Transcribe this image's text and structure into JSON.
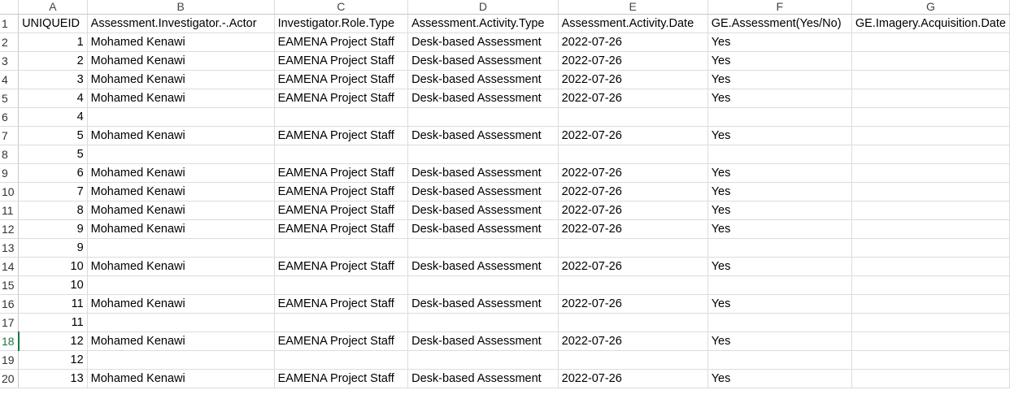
{
  "column_letters": [
    "A",
    "B",
    "C",
    "D",
    "E",
    "F",
    "G"
  ],
  "row_numbers": [
    "1",
    "2",
    "3",
    "4",
    "5",
    "6",
    "7",
    "8",
    "9",
    "10",
    "11",
    "12",
    "13",
    "14",
    "15",
    "16",
    "17",
    "18",
    "19",
    "20"
  ],
  "active_row": "18",
  "header_row": [
    "UNIQUEID",
    "Assessment.Investigator.-.Actor",
    "Investigator.Role.Type",
    "Assessment.Activity.Type",
    "Assessment.Activity.Date",
    "GE.Assessment(Yes/No)",
    "GE.Imagery.Acquisition.Date"
  ],
  "rows": [
    [
      "1",
      "Mohamed Kenawi",
      "EAMENA Project Staff",
      "Desk-based Assessment",
      "2022-07-26",
      "Yes",
      ""
    ],
    [
      "2",
      "Mohamed Kenawi",
      "EAMENA Project Staff",
      "Desk-based Assessment",
      "2022-07-26",
      "Yes",
      ""
    ],
    [
      "3",
      "Mohamed Kenawi",
      "EAMENA Project Staff",
      "Desk-based Assessment",
      "2022-07-26",
      "Yes",
      ""
    ],
    [
      "4",
      "Mohamed Kenawi",
      "EAMENA Project Staff",
      "Desk-based Assessment",
      "2022-07-26",
      "Yes",
      ""
    ],
    [
      "4",
      "",
      "",
      "",
      "",
      "",
      ""
    ],
    [
      "5",
      "Mohamed Kenawi",
      "EAMENA Project Staff",
      "Desk-based Assessment",
      "2022-07-26",
      "Yes",
      ""
    ],
    [
      "5",
      "",
      "",
      "",
      "",
      "",
      ""
    ],
    [
      "6",
      "Mohamed Kenawi",
      "EAMENA Project Staff",
      "Desk-based Assessment",
      "2022-07-26",
      "Yes",
      ""
    ],
    [
      "7",
      "Mohamed Kenawi",
      "EAMENA Project Staff",
      "Desk-based Assessment",
      "2022-07-26",
      "Yes",
      ""
    ],
    [
      "8",
      "Mohamed Kenawi",
      "EAMENA Project Staff",
      "Desk-based Assessment",
      "2022-07-26",
      "Yes",
      ""
    ],
    [
      "9",
      "Mohamed Kenawi",
      "EAMENA Project Staff",
      "Desk-based Assessment",
      "2022-07-26",
      "Yes",
      ""
    ],
    [
      "9",
      "",
      "",
      "",
      "",
      "",
      ""
    ],
    [
      "10",
      "Mohamed Kenawi",
      "EAMENA Project Staff",
      "Desk-based Assessment",
      "2022-07-26",
      "Yes",
      ""
    ],
    [
      "10",
      "",
      "",
      "",
      "",
      "",
      ""
    ],
    [
      "11",
      "Mohamed Kenawi",
      "EAMENA Project Staff",
      "Desk-based Assessment",
      "2022-07-26",
      "Yes",
      ""
    ],
    [
      "11",
      "",
      "",
      "",
      "",
      "",
      ""
    ],
    [
      "12",
      "Mohamed Kenawi",
      "EAMENA Project Staff",
      "Desk-based Assessment",
      "2022-07-26",
      "Yes",
      ""
    ],
    [
      "12",
      "",
      "",
      "",
      "",
      "",
      ""
    ],
    [
      "13",
      "Mohamed Kenawi",
      "EAMENA Project Staff",
      "Desk-based Assessment",
      "2022-07-26",
      "Yes",
      ""
    ]
  ],
  "colors": {
    "gridline": "#dadcdf",
    "active_header": "#217346"
  }
}
